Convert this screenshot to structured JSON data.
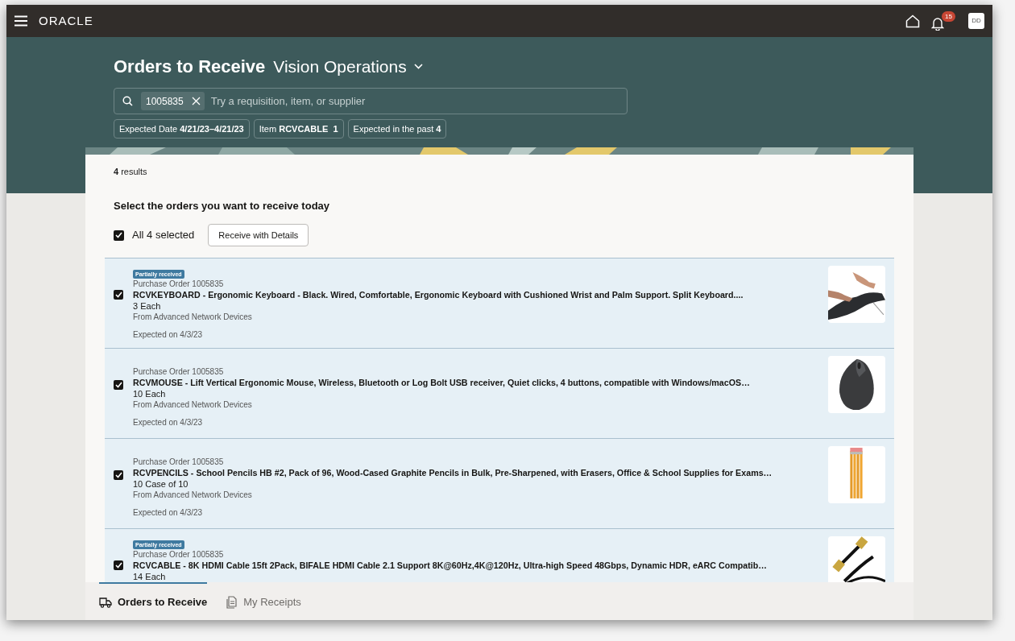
{
  "top_bar": {
    "logo": "ORACLE",
    "notification_count": "15",
    "avatar": "DD"
  },
  "header": {
    "title": "Orders to Receive",
    "organization": "Vision Operations"
  },
  "search": {
    "token": "1005835",
    "placeholder": "Try a requisition, item, or supplier"
  },
  "filters": [
    {
      "text": "Expected Date **4/21/23–4/21/23**"
    },
    {
      "text": "Item **RCVCABLE  1**"
    },
    {
      "text": "Expected in the past **4**"
    }
  ],
  "results_count": "**4** results",
  "instruction": "Select the orders you want to receive today",
  "select_all": {
    "label": "All 4 selected",
    "checked": true
  },
  "receive_button": "Receive with Details",
  "orders": [
    {
      "badge": "Partially received",
      "po": "Purchase Order 1005835",
      "title": "RCVKEYBOARD - Ergonomic Keyboard - Black. Wired, Comfortable, Ergonomic Keyboard with Cushioned Wrist and Palm Support. Split Keyboard....",
      "quantity": "3 Each",
      "supplier": "From Advanced Network Devices",
      "expected": "Expected on 4/3/23",
      "checked": true,
      "kind": "keyboard"
    },
    {
      "po": "Purchase Order 1005835",
      "title": "RCVMOUSE - Lift Vertical Ergonomic Mouse, Wireless, Bluetooth or Log Bolt USB receiver, Quiet clicks, 4 buttons, compatible with Windows/macOS…",
      "quantity": "10 Each",
      "supplier": "From Advanced Network Devices",
      "expected": "Expected on 4/3/23",
      "checked": true,
      "kind": "mouse"
    },
    {
      "po": "Purchase Order 1005835",
      "title": "RCVPENCILS - School Pencils HB #2, Pack of 96, Wood-Cased Graphite Pencils in Bulk, Pre-Sharpened, with Erasers, Office & School Supplies for Exams…",
      "quantity": "10 Case of 10",
      "supplier": "From Advanced Network Devices",
      "expected": "Expected on 4/3/23",
      "checked": true,
      "kind": "pencils"
    },
    {
      "badge": "Partially received",
      "po": "Purchase Order 1005835",
      "title": "RCVCABLE - 8K HDMI Cable 15ft 2Pack, BIFALE HDMI Cable 2.1 Support 8K@60Hz,4K@120Hz, Ultra-high Speed 48Gbps, Dynamic HDR, eARC Compatib…",
      "quantity": "14 Each",
      "checked": true,
      "kind": "cable"
    }
  ],
  "bottom_tabs": [
    {
      "label": "Orders to Receive",
      "selected": true,
      "kind": "truck"
    },
    {
      "label": "My Receipts",
      "selected": false,
      "kind": "document"
    }
  ]
}
